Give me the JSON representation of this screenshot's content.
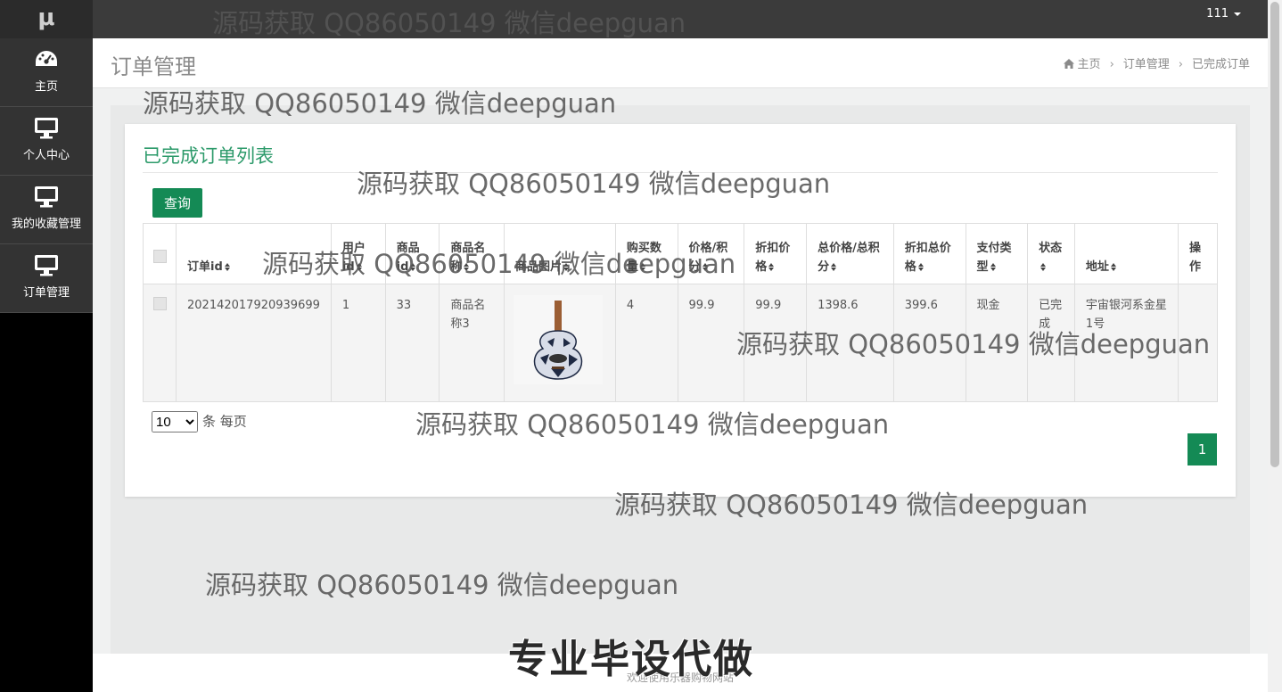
{
  "logo": "μ",
  "user": {
    "name": "111"
  },
  "sidebar": {
    "items": [
      {
        "label": "主页",
        "icon": "dashboard-icon"
      },
      {
        "label": "个人中心",
        "icon": "monitor-icon"
      },
      {
        "label": "我的收藏管理",
        "icon": "monitor-icon"
      },
      {
        "label": "订单管理",
        "icon": "monitor-icon"
      }
    ]
  },
  "header": {
    "title": "订单管理",
    "breadcrumb": [
      "主页",
      "订单管理",
      "已完成订单"
    ]
  },
  "panel": {
    "title": "已完成订单列表",
    "query_label": "查询"
  },
  "table": {
    "headers": [
      "订单id",
      "用户id",
      "商品id",
      "商品名称",
      "商品图片",
      "购买数量",
      "价格/积分",
      "折扣价格",
      "总价格/总积分",
      "折扣总价格",
      "支付类型",
      "状态",
      "地址",
      "操作"
    ],
    "rows": [
      {
        "order_id": "202142017920939699",
        "user_id": "1",
        "goods_id": "33",
        "goods_name": "商品名称3",
        "qty": "4",
        "price": "99.9",
        "discount_price": "99.9",
        "total": "1398.6",
        "discount_total": "399.6",
        "pay_type": "现金",
        "status": "已完成",
        "address": "宇宙银河系金星1号"
      }
    ]
  },
  "pager": {
    "page_size": "10",
    "page_size_options": [
      "10"
    ],
    "per_page_label": "条 每页",
    "current_page": "1"
  },
  "footer": {
    "text": "欢迎使用乐器购物网站"
  },
  "watermark": {
    "text": "源码获取 QQ86050149 微信deepguan"
  },
  "banner": {
    "text": "专业毕设代做"
  },
  "colors": {
    "accent": "#148a55",
    "title_green": "#2c9a6a",
    "topbar": "#3b3b3b"
  }
}
